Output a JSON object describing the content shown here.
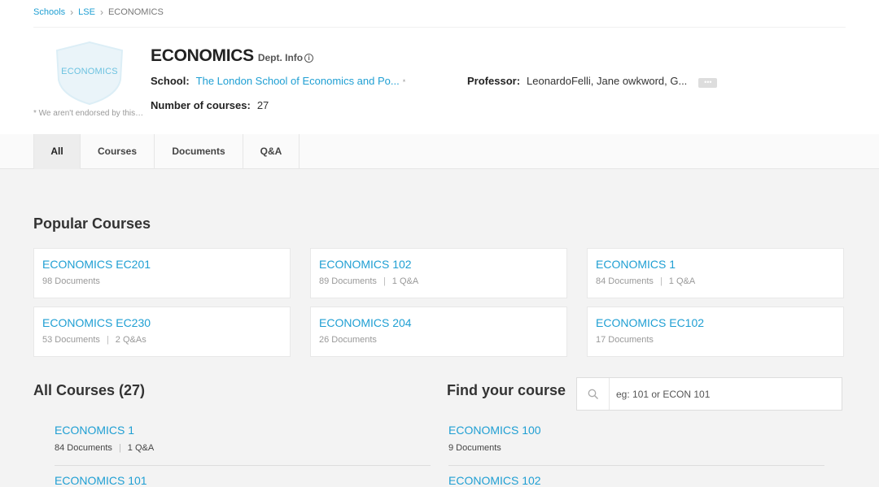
{
  "breadcrumb": {
    "items": [
      "Schools",
      "LSE"
    ],
    "current": "ECONOMICS"
  },
  "logo": {
    "text": "ECONOMICS",
    "disclaimer": "* We aren't endorsed by this school"
  },
  "department": {
    "title": "ECONOMICS",
    "info_label": "Dept. Info",
    "school_label": "School:",
    "school_value": "The London School of Economics and Po...",
    "school_marker": "*",
    "courses_label": "Number of courses:",
    "courses_value": "27",
    "professor_label": "Professor:",
    "professor_value": "LeonardoFelli, Jane owkword, G...",
    "more_label": "•••"
  },
  "tabs": [
    {
      "label": "All",
      "active": true
    },
    {
      "label": "Courses"
    },
    {
      "label": "Documents"
    },
    {
      "label": "Q&A"
    }
  ],
  "popular": {
    "title": "Popular Courses",
    "cards": [
      {
        "name": "ECONOMICS EC201",
        "docs": "98 Documents",
        "qa": ""
      },
      {
        "name": "ECONOMICS 102",
        "docs": "89 Documents",
        "qa": "1 Q&A"
      },
      {
        "name": "ECONOMICS 1",
        "docs": "84 Documents",
        "qa": "1 Q&A"
      },
      {
        "name": "ECONOMICS EC230",
        "docs": "53 Documents",
        "qa": "2 Q&As"
      },
      {
        "name": "ECONOMICS 204",
        "docs": "26 Documents",
        "qa": ""
      },
      {
        "name": "ECONOMICS EC102",
        "docs": "17 Documents",
        "qa": ""
      }
    ]
  },
  "all_courses": {
    "title": "All Courses (27)",
    "find_title": "Find your course",
    "search_placeholder": "eg: 101 or ECON 101",
    "left": [
      {
        "name": "ECONOMICS 1",
        "docs": "84 Documents",
        "qa": "1 Q&A"
      },
      {
        "name": "ECONOMICS 101",
        "docs": "",
        "qa": ""
      }
    ],
    "right": [
      {
        "name": "ECONOMICS 100",
        "docs": "9 Documents",
        "qa": ""
      },
      {
        "name": "ECONOMICS 102",
        "docs": "",
        "qa": ""
      }
    ]
  },
  "colors": {
    "link": "#1f9fd3",
    "background": "#f3f3f3",
    "shield": "#eaf4f9"
  }
}
